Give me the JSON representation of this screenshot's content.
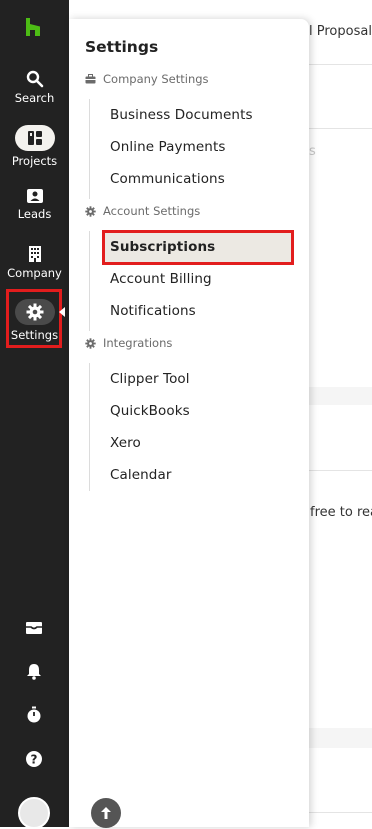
{
  "rail": {
    "items": [
      {
        "label": "Search",
        "icon": "search-icon"
      },
      {
        "label": "Projects",
        "icon": "projects-icon"
      },
      {
        "label": "Leads",
        "icon": "leads-icon"
      },
      {
        "label": "Company",
        "icon": "company-icon"
      },
      {
        "label": "Settings",
        "icon": "gear-icon",
        "active": true
      }
    ],
    "bottom_icons": [
      "inbox-icon",
      "bell-icon",
      "timer-icon",
      "help-icon",
      "avatar"
    ]
  },
  "background": {
    "proposal_text": "l Proposal",
    "faded_text": "s",
    "free_text": "free to rea"
  },
  "settings_panel": {
    "title": "Settings",
    "groups": [
      {
        "label": "Company Settings",
        "icon": "briefcase-icon",
        "items": [
          "Business Documents",
          "Online Payments",
          "Communications"
        ]
      },
      {
        "label": "Account Settings",
        "icon": "gear-icon",
        "items": [
          "Subscriptions",
          "Account Billing",
          "Notifications"
        ],
        "active_item": "Subscriptions"
      },
      {
        "label": "Integrations",
        "icon": "gear-icon",
        "items": [
          "Clipper Tool",
          "QuickBooks",
          "Xero",
          "Calendar"
        ]
      }
    ]
  },
  "colors": {
    "rail_bg": "#222222",
    "brand_green": "#4dbc15",
    "highlight_red": "#e21d1d",
    "active_item_bg": "#ece9e3"
  }
}
